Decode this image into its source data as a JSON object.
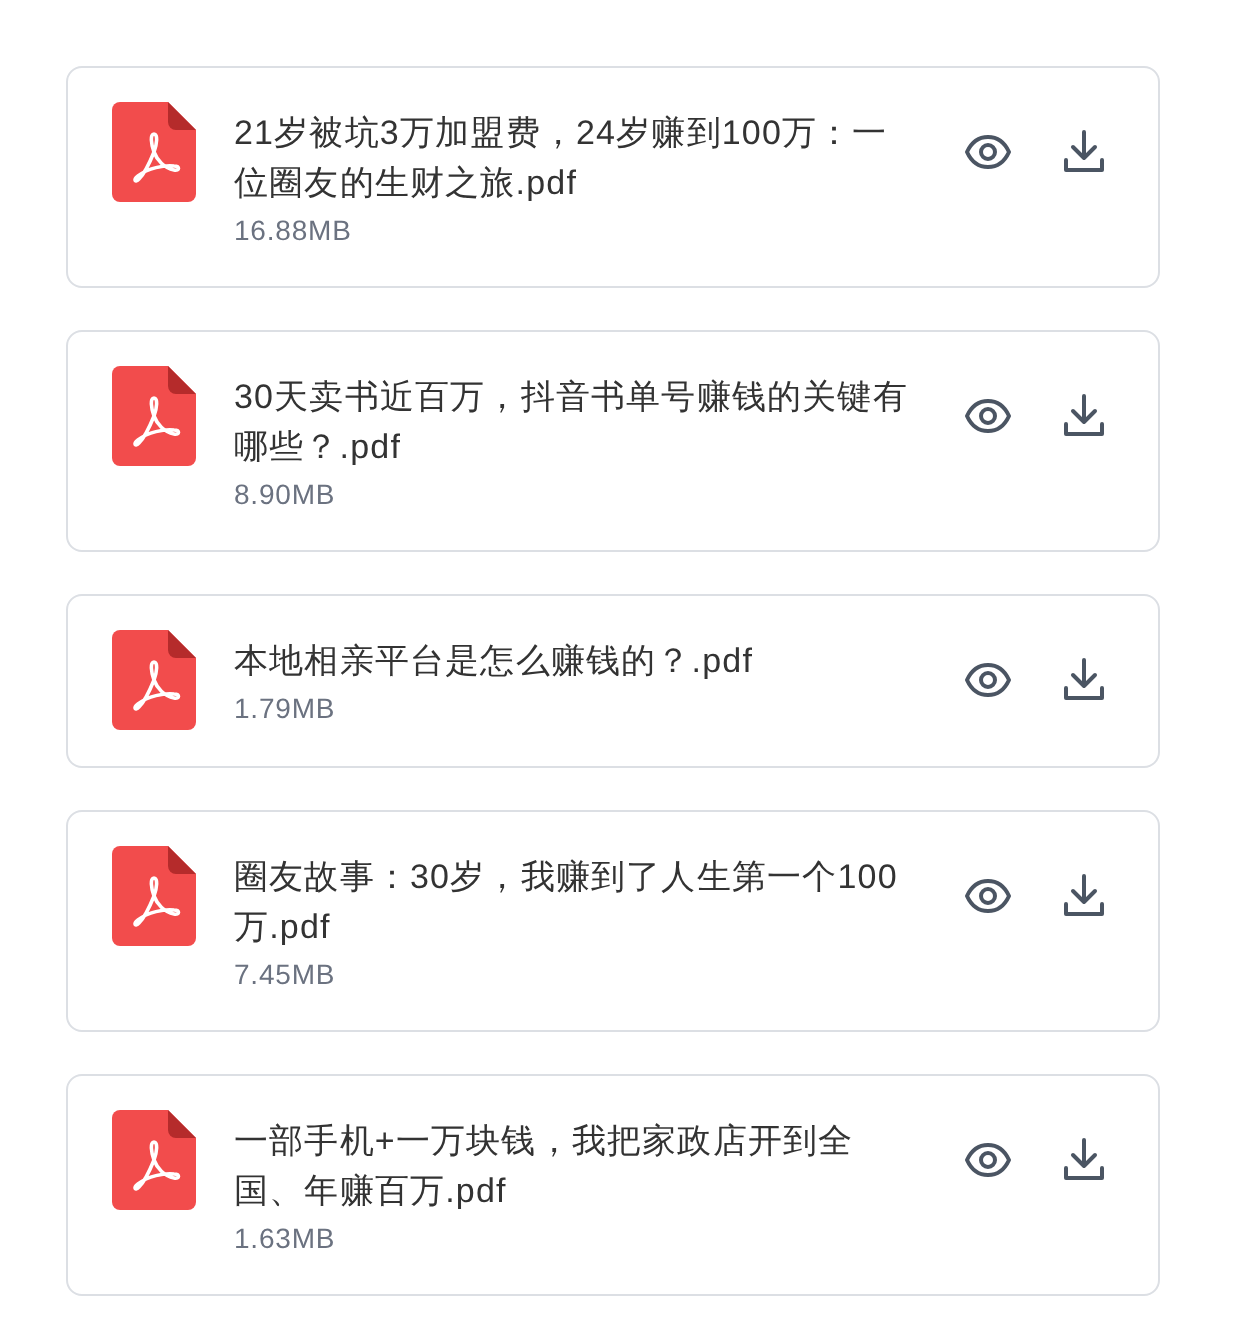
{
  "files": [
    {
      "name": "21岁被坑3万加盟费，24岁赚到100万：一位圈友的生财之旅.pdf",
      "size": "16.88MB"
    },
    {
      "name": "30天卖书近百万，抖音书单号赚钱的关键有哪些？.pdf",
      "size": "8.90MB"
    },
    {
      "name": "本地相亲平台是怎么赚钱的？.pdf",
      "size": "1.79MB"
    },
    {
      "name": "圈友故事：30岁，我赚到了人生第一个100万.pdf",
      "size": "7.45MB"
    },
    {
      "name": "一部手机+一万块钱，我把家政店开到全国、年赚百万.pdf",
      "size": "1.63MB"
    }
  ]
}
